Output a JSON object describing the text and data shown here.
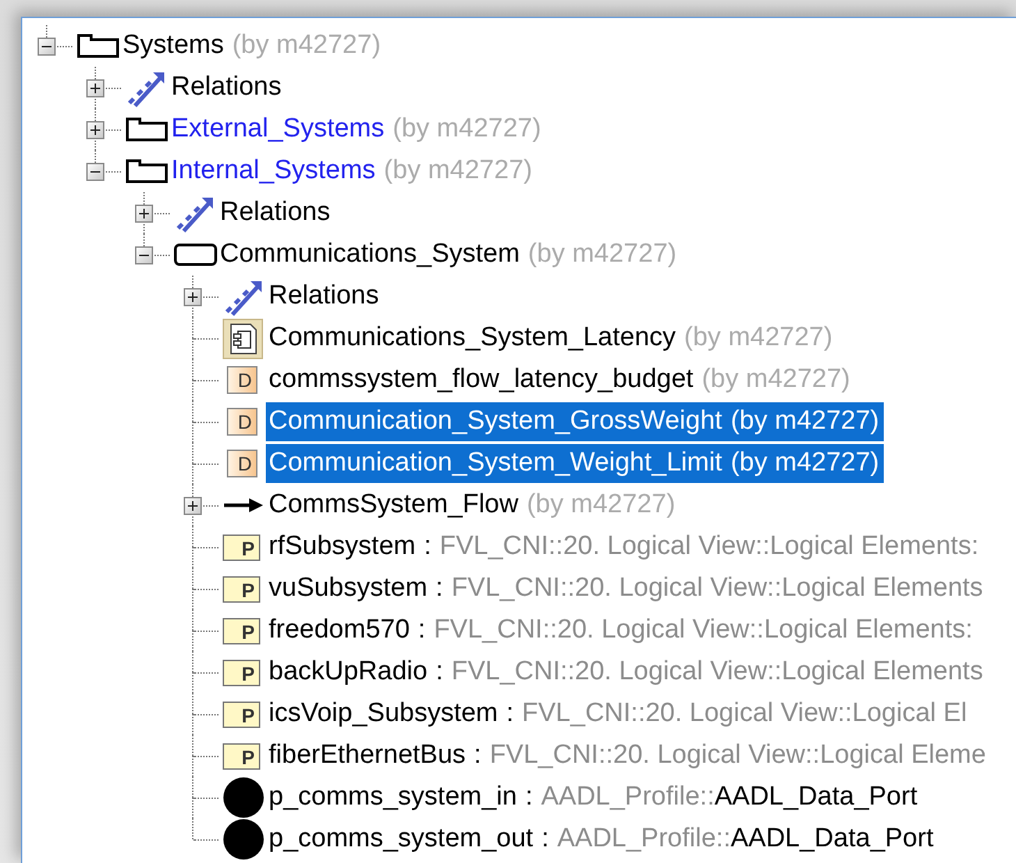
{
  "tree": {
    "items": [
      {
        "kind": "folder",
        "label": "Systems",
        "owner": "(by m42727)",
        "expanded": true,
        "selected": false,
        "children": [
          {
            "kind": "relations",
            "label": "Relations",
            "expanded": false,
            "selected": false
          },
          {
            "kind": "folder",
            "label": "External_Systems",
            "color": "#2222ee",
            "owner": "(by m42727)",
            "expanded": false,
            "selected": false
          },
          {
            "kind": "folder",
            "label": "Internal_Systems",
            "color": "#2222ee",
            "owner": "(by m42727)",
            "expanded": true,
            "selected": false,
            "children": [
              {
                "kind": "relations",
                "label": "Relations",
                "expanded": false,
                "selected": false
              },
              {
                "kind": "block",
                "label": "Communications_System",
                "owner": "(by m42727)",
                "expanded": true,
                "selected": false,
                "children": [
                  {
                    "kind": "relations",
                    "label": "Relations",
                    "expanded": false,
                    "selected": false
                  },
                  {
                    "kind": "constraint",
                    "label": "Communications_System_Latency",
                    "owner": "(by m42727)",
                    "selected": false
                  },
                  {
                    "kind": "data",
                    "letter": "D",
                    "label": "commssystem_flow_latency_budget",
                    "owner": "(by m42727)",
                    "selected": false
                  },
                  {
                    "kind": "data",
                    "letter": "D",
                    "label": "Communication_System_GrossWeight",
                    "owner": "(by m42727)",
                    "selected": true
                  },
                  {
                    "kind": "data",
                    "letter": "D",
                    "label": "Communication_System_Weight_Limit",
                    "owner": "(by m42727)",
                    "selected": true
                  },
                  {
                    "kind": "flow",
                    "label": "CommsSystem_Flow",
                    "owner": "(by m42727)",
                    "expanded": false,
                    "selected": false
                  },
                  {
                    "kind": "part",
                    "letter": "P",
                    "label": "rfSubsystem",
                    "type": [
                      {
                        "text": ":",
                        "muted": false
                      },
                      {
                        "text": "FVL_CNI::20. Logical View::Logical Elements:",
                        "muted": true
                      }
                    ],
                    "selected": false
                  },
                  {
                    "kind": "part",
                    "letter": "P",
                    "label": "vuSubsystem",
                    "type": [
                      {
                        "text": ":",
                        "muted": false
                      },
                      {
                        "text": "FVL_CNI::20. Logical View::Logical Elements",
                        "muted": true
                      }
                    ],
                    "selected": false
                  },
                  {
                    "kind": "part",
                    "letter": "P",
                    "label": "freedom570",
                    "type": [
                      {
                        "text": ":",
                        "muted": false
                      },
                      {
                        "text": "FVL_CNI::20. Logical View::Logical Elements:",
                        "muted": true
                      }
                    ],
                    "selected": false
                  },
                  {
                    "kind": "part",
                    "letter": "P",
                    "label": "backUpRadio",
                    "type": [
                      {
                        "text": ":",
                        "muted": false
                      },
                      {
                        "text": "FVL_CNI::20. Logical View::Logical Elements",
                        "muted": true
                      }
                    ],
                    "selected": false
                  },
                  {
                    "kind": "part",
                    "letter": "P",
                    "label": "icsVoip_Subsystem",
                    "type": [
                      {
                        "text": ":",
                        "muted": false
                      },
                      {
                        "text": "FVL_CNI::20. Logical View::Logical El",
                        "muted": true
                      }
                    ],
                    "selected": false
                  },
                  {
                    "kind": "part",
                    "letter": "P",
                    "label": "fiberEthernetBus",
                    "type": [
                      {
                        "text": ":",
                        "muted": false
                      },
                      {
                        "text": "FVL_CNI::20. Logical View::Logical Eleme",
                        "muted": true
                      }
                    ],
                    "selected": false
                  },
                  {
                    "kind": "port",
                    "label": "p_comms_system_in",
                    "type": [
                      {
                        "text": ":",
                        "muted": false
                      },
                      {
                        "text": "AADL_Profile::",
                        "muted": true
                      },
                      {
                        "text": "AADL_Data_Port",
                        "muted": false
                      }
                    ],
                    "selected": false
                  },
                  {
                    "kind": "port",
                    "label": "p_comms_system_out",
                    "type": [
                      {
                        "text": ":",
                        "muted": false
                      },
                      {
                        "text": "AADL_Profile::",
                        "muted": true
                      },
                      {
                        "text": "AADL_Data_Port",
                        "muted": false
                      }
                    ],
                    "selected": false
                  }
                ]
              }
            ]
          }
        ]
      }
    ]
  }
}
